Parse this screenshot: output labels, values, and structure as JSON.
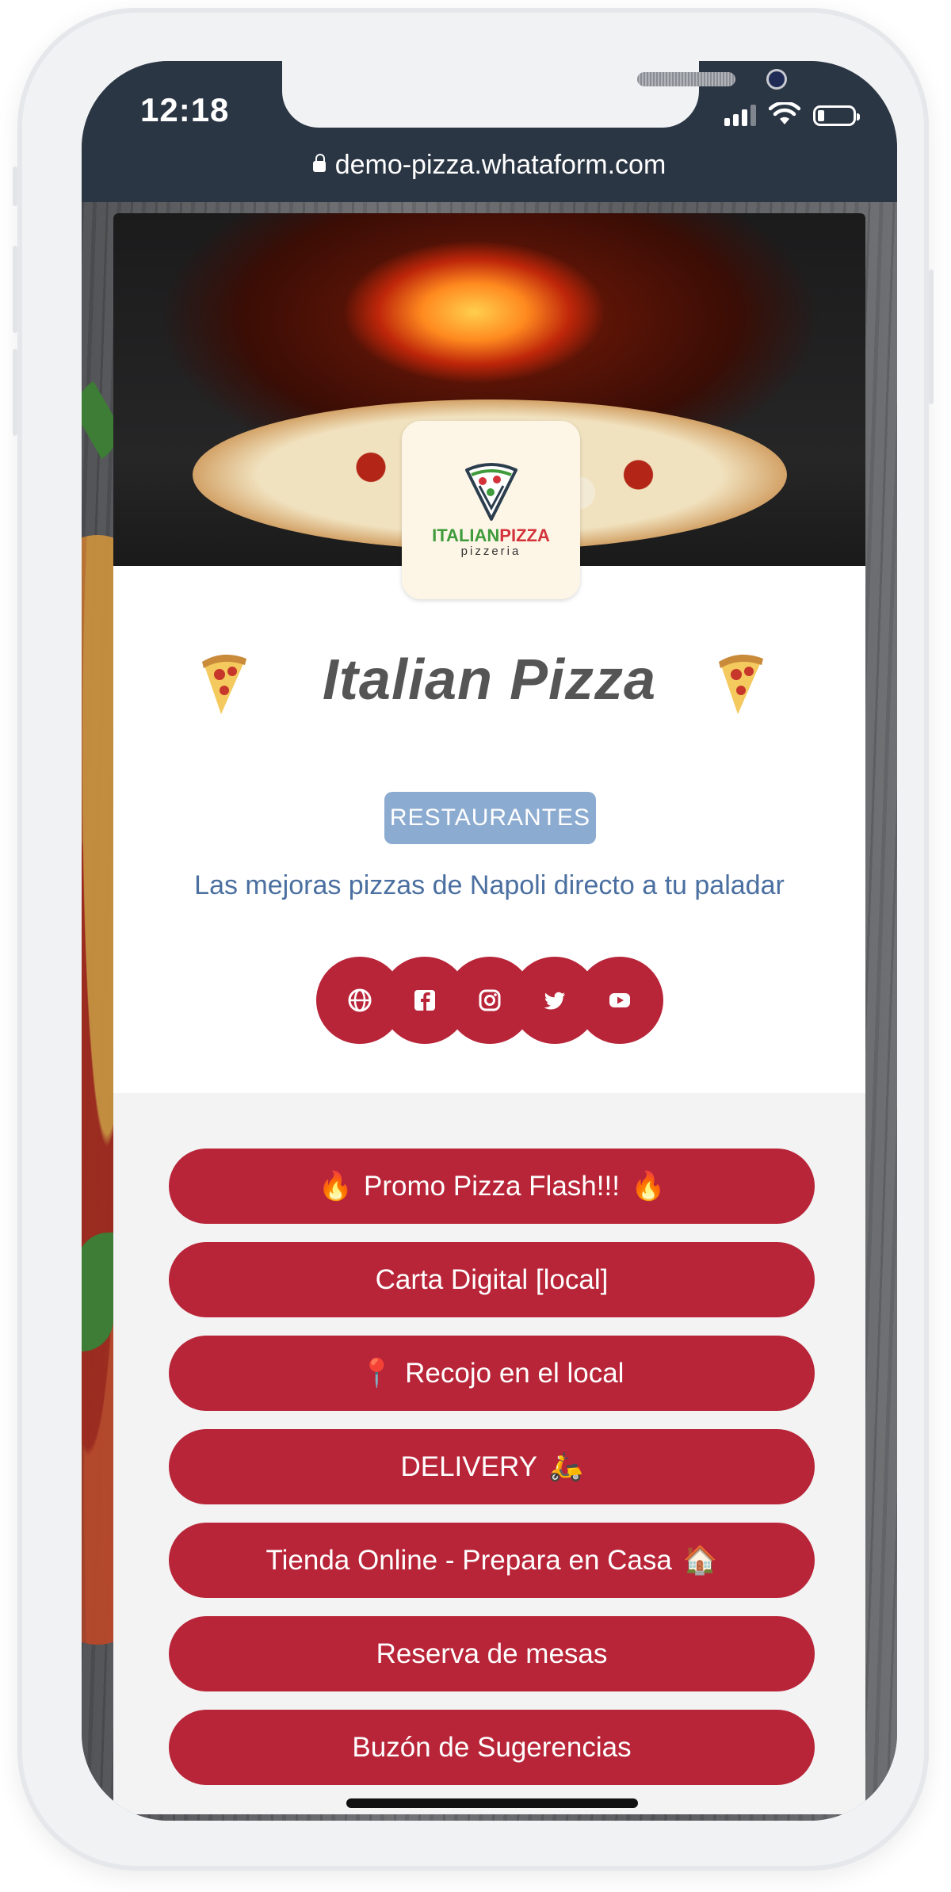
{
  "status_bar": {
    "time": "12:18"
  },
  "browser": {
    "url": "demo-pizza.whataform.com"
  },
  "profile": {
    "logo_main_left": "ITALIAN",
    "logo_main_right": "PIZZA",
    "logo_sub": "pizzeria",
    "title": "Italian Pizza",
    "category": "RESTAURANTES",
    "description": "Las mejoras pizzas de Napoli directo a tu paladar"
  },
  "social": [
    {
      "icon": "globe-icon"
    },
    {
      "icon": "facebook-icon"
    },
    {
      "icon": "instagram-icon"
    },
    {
      "icon": "twitter-icon"
    },
    {
      "icon": "youtube-icon"
    }
  ],
  "links": [
    {
      "label": "Promo Pizza Flash!!!",
      "emoji_before": "🔥",
      "emoji_after": "🔥"
    },
    {
      "label": "Carta Digital [local]"
    },
    {
      "label": "Recojo en el local",
      "emoji_before": "📍"
    },
    {
      "label": "DELIVERY",
      "emoji_after": "🛵"
    },
    {
      "label": "Tienda Online - Prepara en Casa",
      "emoji_after": "🏠"
    },
    {
      "label": "Reserva de mesas"
    },
    {
      "label": "Buzón de Sugerencias"
    }
  ],
  "colors": {
    "accent": "#b82538",
    "category_badge": "#8cabd0",
    "description_text": "#4a6fa0",
    "status_bar": "#2b3644"
  }
}
